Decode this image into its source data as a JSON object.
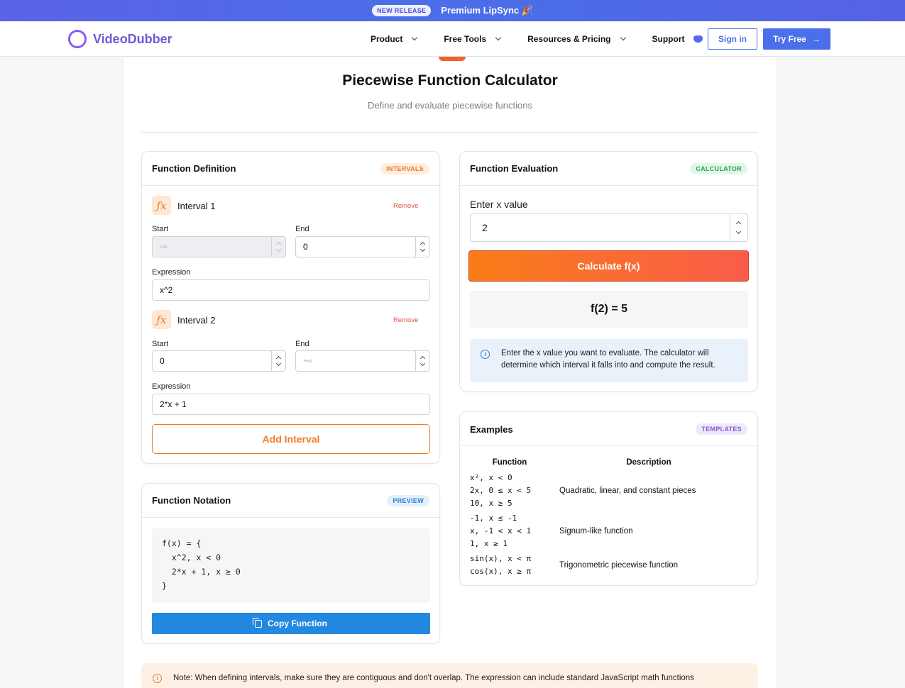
{
  "banner": {
    "badge": "NEW RELEASE",
    "text": "Premium LipSync 🎉"
  },
  "nav": {
    "brand": "VideoDubber",
    "items": [
      "Product",
      "Free Tools",
      "Resources & Pricing",
      "Support"
    ],
    "signin": "Sign in",
    "tryfree": "Try Free",
    "tryfree_arrow": "→"
  },
  "page": {
    "title": "Piecewise Function Calculator",
    "subtitle": "Define and evaluate piecewise functions"
  },
  "definition": {
    "title": "Function Definition",
    "tag": "INTERVALS",
    "icon_glyph": "ƒx",
    "intervals": [
      {
        "title": "Interval 1",
        "remove": "Remove",
        "start_label": "Start",
        "start_value": "",
        "start_placeholder": "-∞",
        "end_label": "End",
        "end_value": "0",
        "expr_label": "Expression",
        "expr_value": "x^2"
      },
      {
        "title": "Interval 2",
        "remove": "Remove",
        "start_label": "Start",
        "start_value": "0",
        "end_label": "End",
        "end_value": "",
        "end_placeholder": "+∞",
        "expr_label": "Expression",
        "expr_value": "2*x + 1"
      }
    ],
    "add_button": "Add Interval"
  },
  "notation": {
    "title": "Function Notation",
    "tag": "PREVIEW",
    "lines": [
      "f(x) = {",
      "  x^2, x < 0",
      "  2*x + 1, x ≥ 0",
      "}"
    ],
    "copy_button": "Copy Function"
  },
  "evaluation": {
    "title": "Function Evaluation",
    "tag": "CALCULATOR",
    "x_label": "Enter x value",
    "x_value": "2",
    "calc_button": "Calculate f(x)",
    "result": "f(2) = 5",
    "info_glyph": "i",
    "info_text": "Enter the x value you want to evaluate. The calculator will determine which interval it falls into and compute the result."
  },
  "examples": {
    "title": "Examples",
    "tag": "TEMPLATES",
    "headers": [
      "Function",
      "Description"
    ],
    "rows": [
      {
        "lines": [
          "x², x < 0",
          "2x, 0 ≤ x < 5",
          "10, x ≥ 5"
        ],
        "description": "Quadratic, linear, and constant pieces"
      },
      {
        "lines": [
          "-1, x ≤ -1",
          "x, -1 < x < 1",
          "1, x ≥ 1"
        ],
        "description": "Signum-like function"
      },
      {
        "lines": [
          "sin(x), x < π",
          "cos(x), x ≥ π"
        ],
        "description": "Trigonometric piecewise function"
      }
    ]
  },
  "note": {
    "glyph": "i",
    "text": "Note: When defining intervals, make sure they are contiguous and don't overlap. The expression can include standard JavaScript math functions"
  },
  "colors": {
    "accent_blue": "#4a6fe8",
    "accent_orange": "#f07a22",
    "tag_intervals": "#f07a22",
    "tag_calculator": "#2aa05a",
    "tag_preview": "#2b7fd7",
    "tag_templates": "#7c5cd6"
  }
}
